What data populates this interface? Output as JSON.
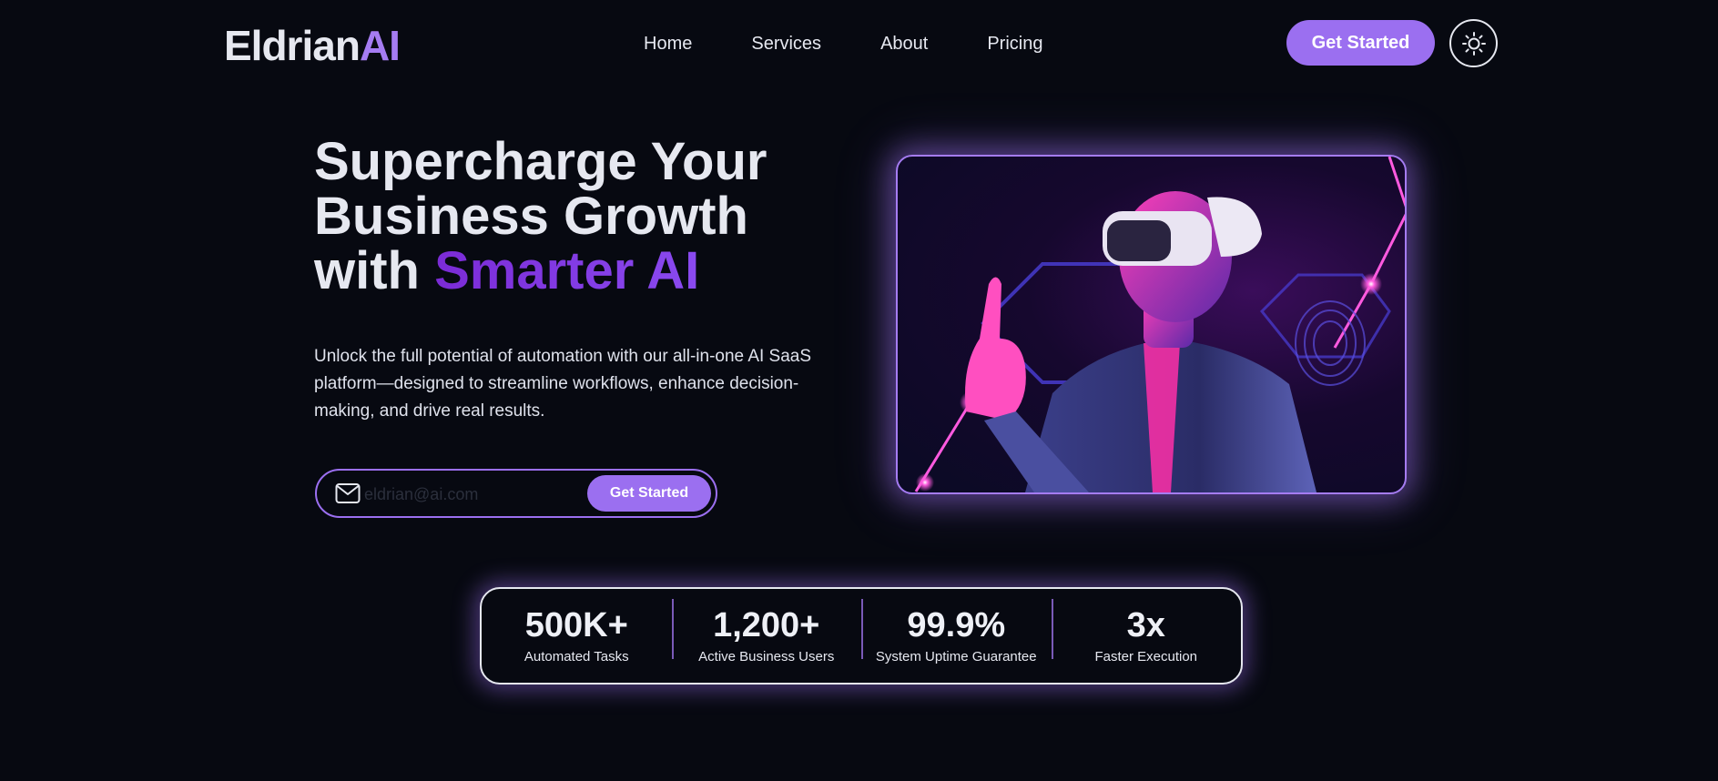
{
  "brand": {
    "name_main": "Eldrian",
    "name_accent": "AI",
    "accent_color": "#a57cf2"
  },
  "nav": {
    "links": [
      {
        "label": "Home"
      },
      {
        "label": "Services"
      },
      {
        "label": "About"
      },
      {
        "label": "Pricing"
      }
    ],
    "cta_label": "Get Started",
    "theme_toggle_icon": "sun-icon"
  },
  "hero": {
    "title_line1": "Supercharge Your",
    "title_line2": "Business Growth",
    "title_line3_prefix": "with ",
    "title_line3_accent": "Smarter AI",
    "description": "Unlock the full potential of automation with our all-in-one AI SaaS platform—designed to streamline workflows, enhance decision-making, and drive real results.",
    "email_placeholder": "eldrian@ai.com",
    "email_icon": "mail-icon",
    "subscribe_label": "Get Started",
    "image_icon": "vr-person-image"
  },
  "stats": [
    {
      "value": "500K+",
      "label": "Automated Tasks"
    },
    {
      "value": "1,200+",
      "label": "Active Business Users"
    },
    {
      "value": "99.9%",
      "label": "System Uptime Guarantee"
    },
    {
      "value": "3x",
      "label": "Faster Execution"
    }
  ],
  "colors": {
    "background": "#070911",
    "primary": "#9b6ff0",
    "accent_gradient_start": "#7b2bd6",
    "accent_gradient_end": "#8a4af0",
    "text": "#e6e8f0"
  }
}
